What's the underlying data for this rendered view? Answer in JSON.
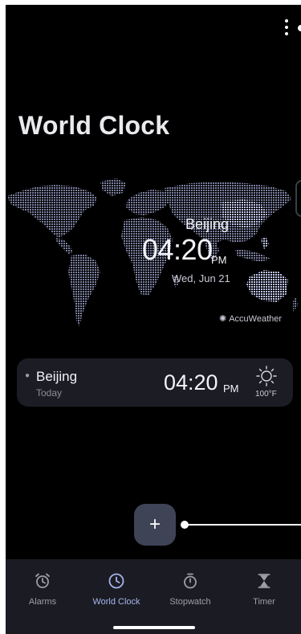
{
  "header": {
    "title": "World Clock"
  },
  "map": {
    "city": "Beijing",
    "time": "04:20",
    "ampm": "PM",
    "date": "Wed, Jun 21",
    "attribution": "AccuWeather"
  },
  "cities": [
    {
      "name": "Beijing",
      "day": "Today",
      "time": "04:20",
      "ampm": "PM",
      "temperature": "100°F",
      "weather_icon": "sun-icon"
    }
  ],
  "add_button": {
    "label": "+"
  },
  "nav": {
    "items": [
      {
        "label": "Alarms",
        "icon": "alarm-icon",
        "active": false
      },
      {
        "label": "World Clock",
        "icon": "clock-icon",
        "active": true
      },
      {
        "label": "Stopwatch",
        "icon": "stopwatch-icon",
        "active": false
      },
      {
        "label": "Timer",
        "icon": "hourglass-icon",
        "active": false
      }
    ]
  },
  "colors": {
    "background": "#000000",
    "card": "#1c1d24",
    "nav_background": "#1b1c23",
    "accent": "#a6b4ee",
    "map_dots": "#8d91b2"
  }
}
